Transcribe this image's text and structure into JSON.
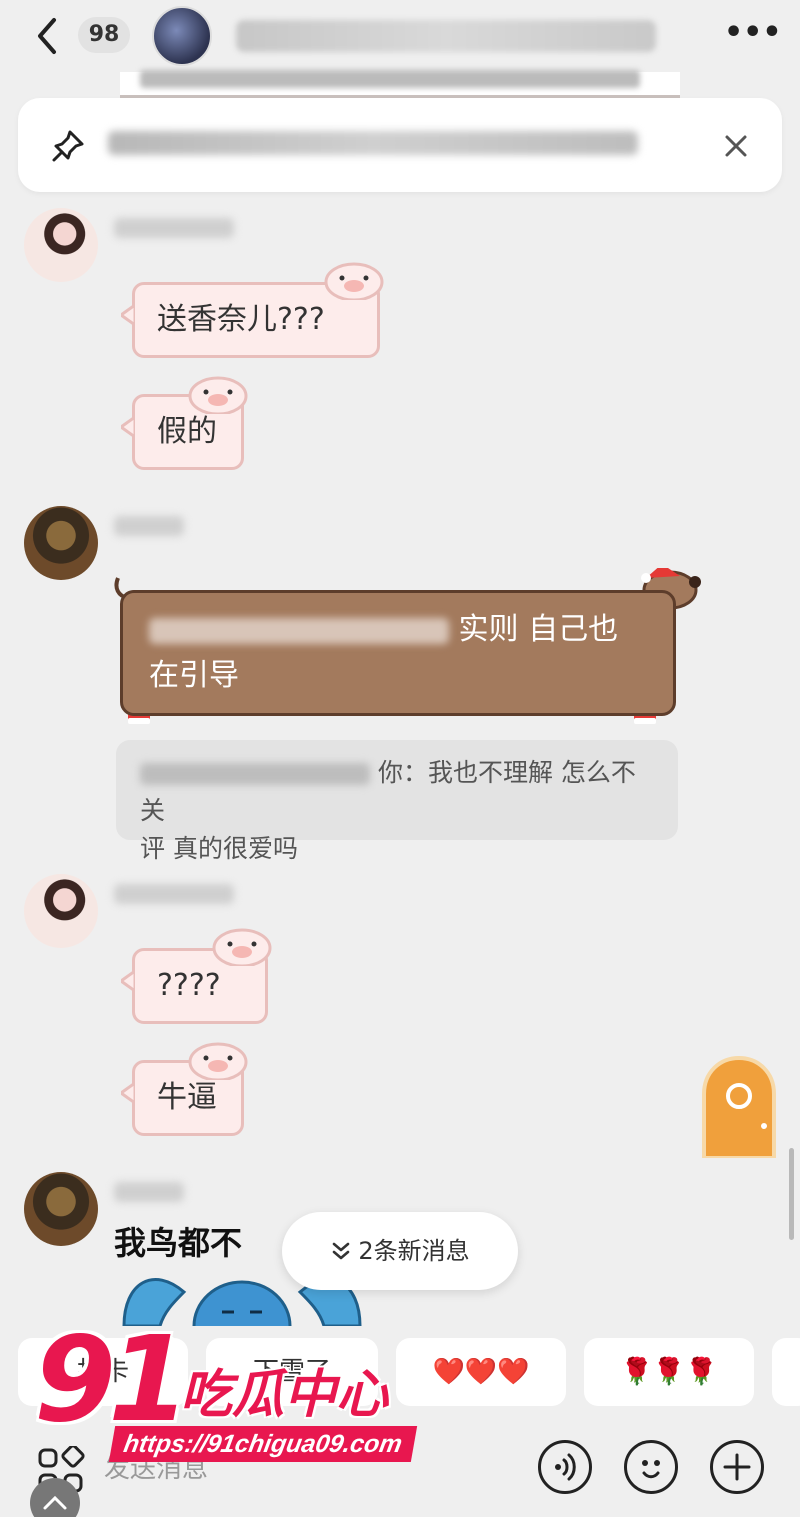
{
  "header": {
    "unread_count": "98",
    "more_label": "•••"
  },
  "pinned": {
    "icon": "pin-icon"
  },
  "messages": {
    "m1_text": "送香奈儿???",
    "m2_text": "假的",
    "m3_text_visible": "实则 自己也",
    "m3_text_line2": "在引导",
    "m3_quote_visible": "你：我也不理解 怎么不关",
    "m3_quote_line2": "评 真的很爱吗",
    "m4_text": "????",
    "m5_text": "牛逼",
    "m6_sticker_text": "我鸟都不"
  },
  "new_messages_pill": {
    "label": "2条新消息",
    "icon": "double-chevron-down-icon"
  },
  "quick_replies": [
    {
      "label": "打卡"
    },
    {
      "label": "下雪了"
    },
    {
      "label": "❤️❤️❤️"
    },
    {
      "label": "🌹🌹🌹"
    }
  ],
  "input": {
    "placeholder": "发送消息"
  },
  "watermark": {
    "number": "91",
    "name": "吃瓜中心",
    "url": "https://91chigua09.com"
  },
  "colors": {
    "background": "#efefef",
    "pig_bubble_fill": "#fdeceb",
    "pig_bubble_border": "#e8bebb",
    "dog_bubble_fill": "#a37a5d",
    "watermark_red": "#e8174f"
  }
}
